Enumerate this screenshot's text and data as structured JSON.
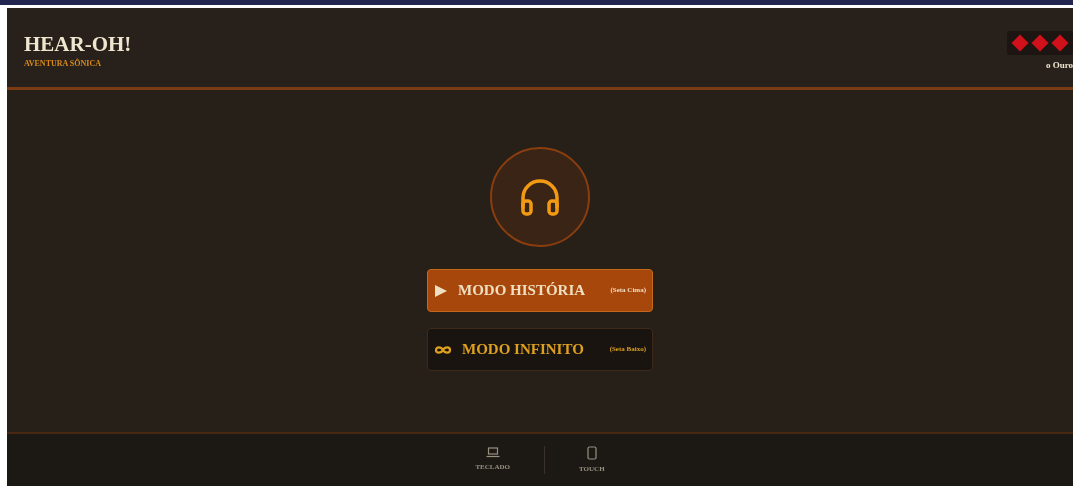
{
  "header": {
    "title": "HEAR-OH!",
    "subtitle": "AVENTURA SÔNICA",
    "lives": [
      {
        "filled": true
      },
      {
        "filled": true
      },
      {
        "filled": true
      }
    ],
    "rank": "o Ouro"
  },
  "modes": [
    {
      "kind": "story",
      "label": "MODO HISTÓRIA",
      "hint": "(Seta Cima)",
      "selected": true
    },
    {
      "kind": "infinite",
      "label": "MODO INFINITO",
      "hint": "(Seta Baixo)",
      "selected": false
    }
  ],
  "footer": {
    "inputs": [
      {
        "kind": "keyboard",
        "label": "TECLADO"
      },
      {
        "kind": "touch",
        "label": "TOUCH"
      }
    ]
  }
}
